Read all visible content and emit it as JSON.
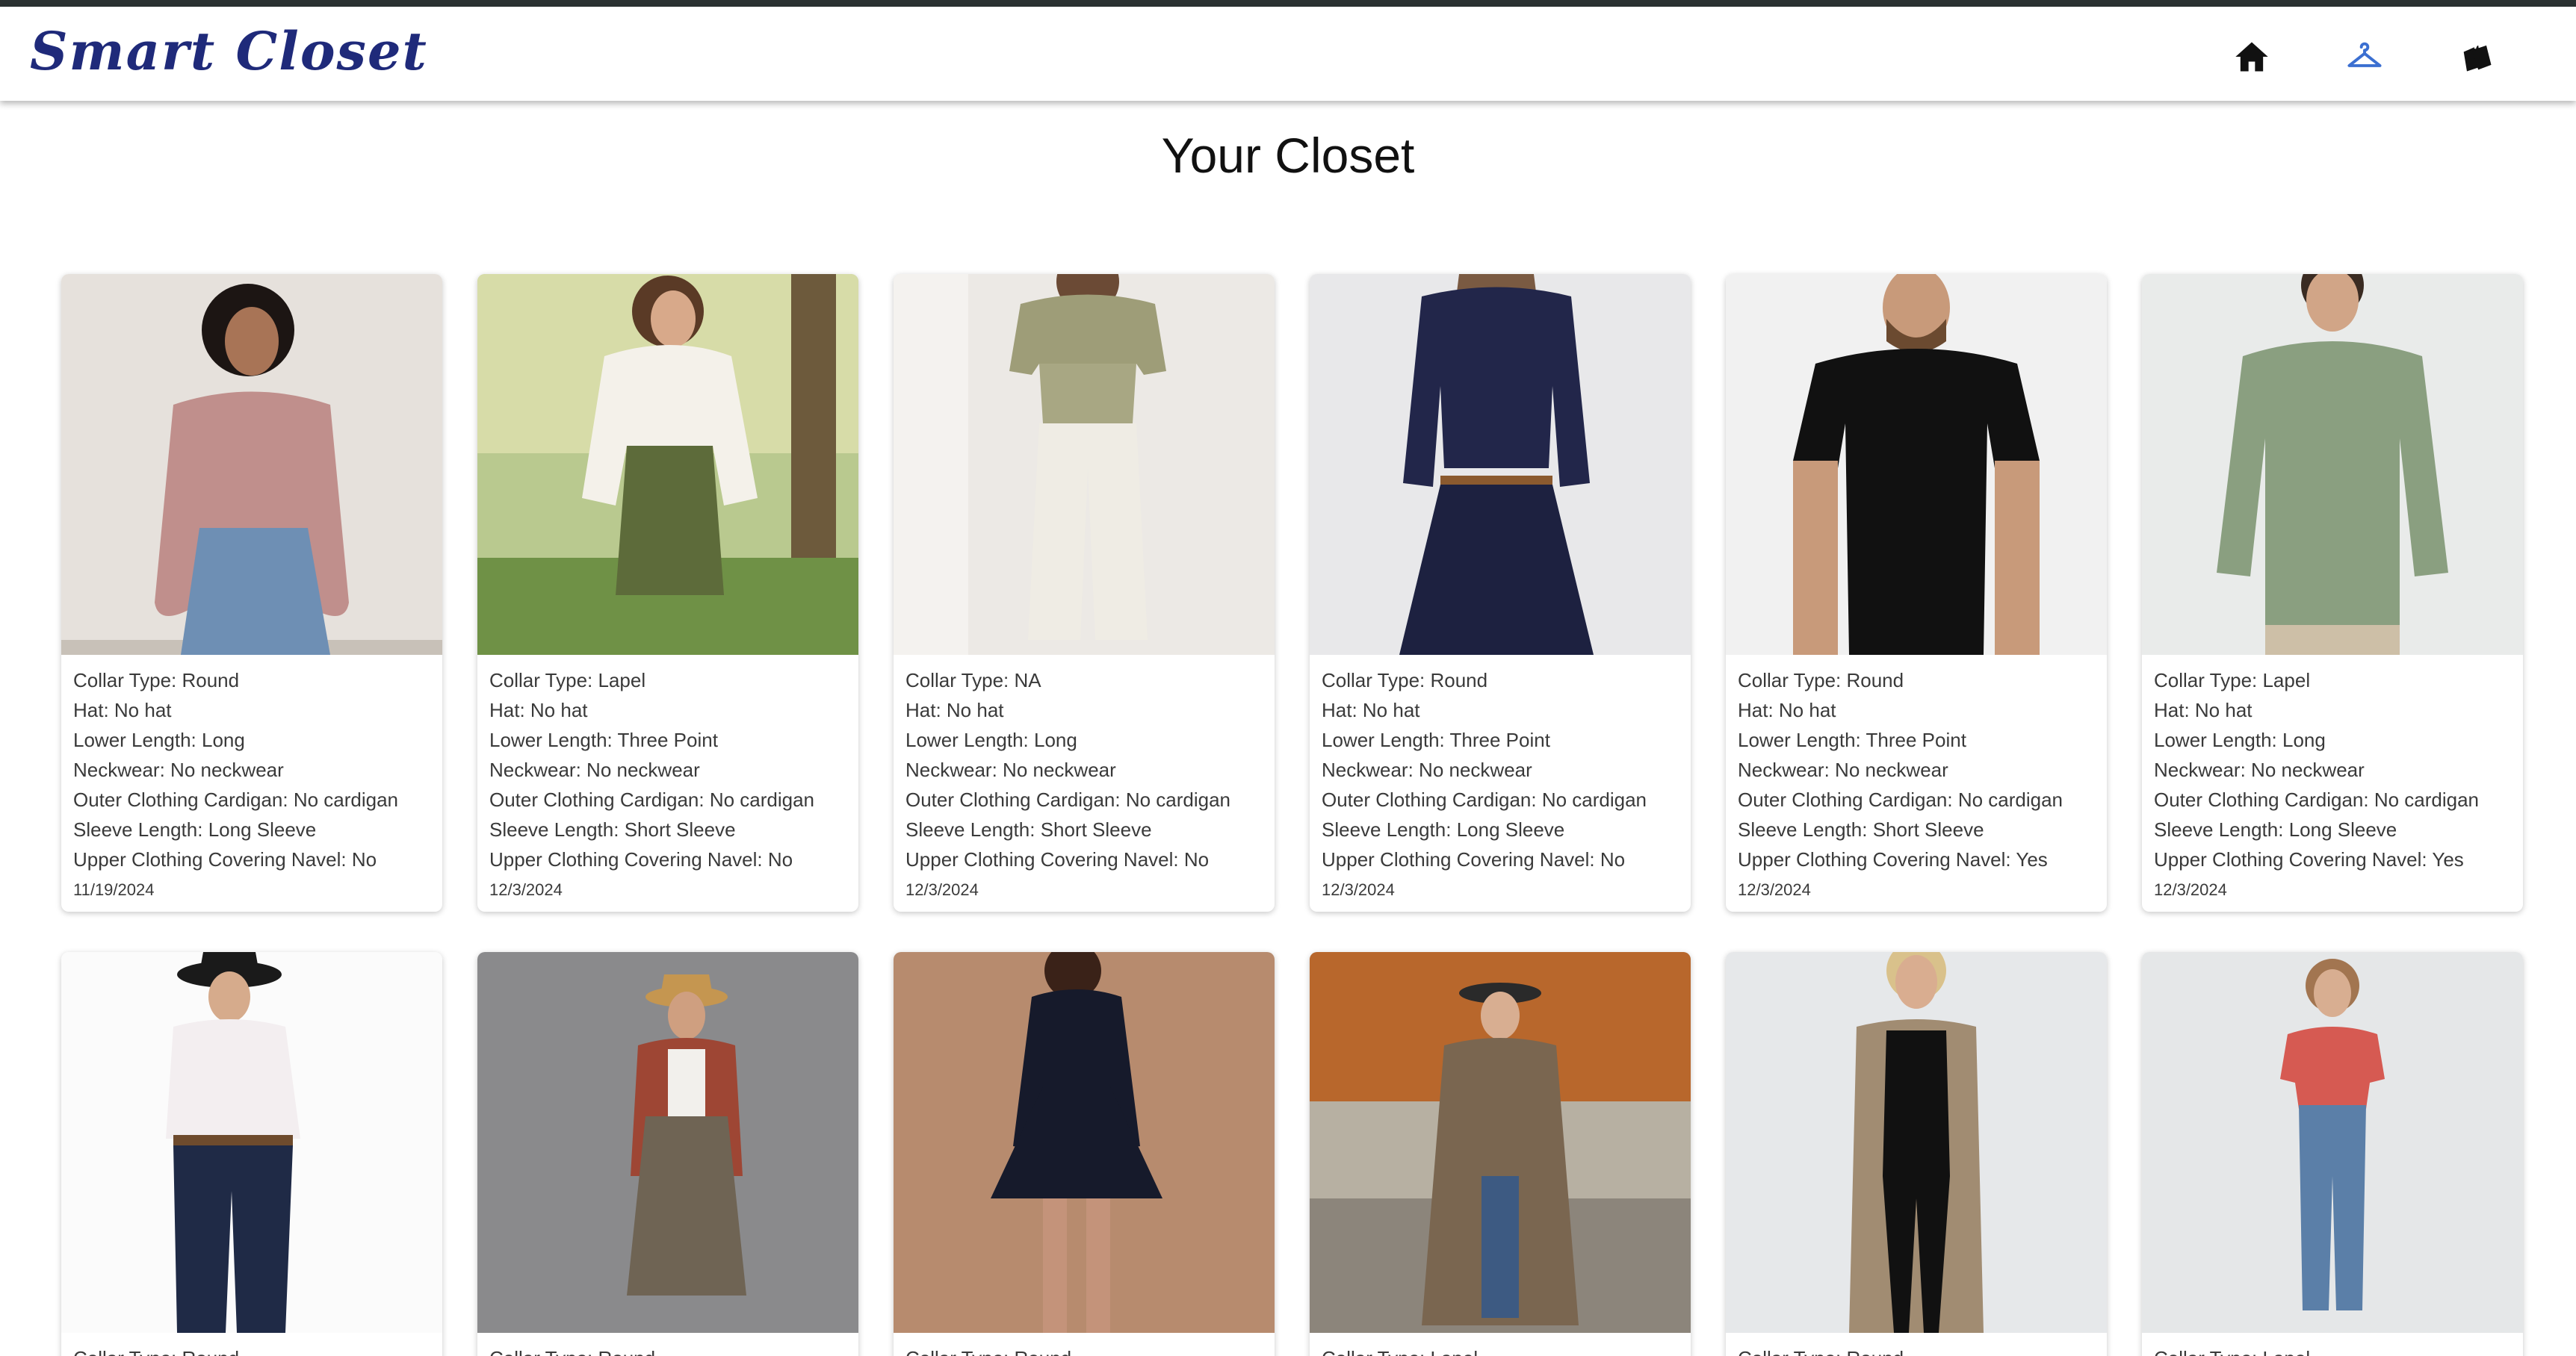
{
  "app": {
    "title": "Smart Closet"
  },
  "nav": {
    "home_icon": "home-icon",
    "closet_icon": "hanger-icon",
    "shop_icon": "shopping-bag-icon",
    "active_color": "#3b6fd1",
    "brand_color": "#1f2a7a"
  },
  "page": {
    "title": "Your Closet"
  },
  "items": [
    {
      "lines": [
        "Collar Type: Round",
        "Hat: No hat",
        "Lower Length: Long",
        "Neckwear: No neckwear",
        "Outer Clothing Cardigan: No cardigan",
        "Sleeve Length: Long Sleeve",
        "Upper Clothing Covering Navel: No"
      ],
      "date": "11/19/2024"
    },
    {
      "lines": [
        "Collar Type: Lapel",
        "Hat: No hat",
        "Lower Length: Three Point",
        "Neckwear: No neckwear",
        "Outer Clothing Cardigan: No cardigan",
        "Sleeve Length: Short Sleeve",
        "Upper Clothing Covering Navel: No"
      ],
      "date": "12/3/2024"
    },
    {
      "lines": [
        "Collar Type: NA",
        "Hat: No hat",
        "Lower Length: Long",
        "Neckwear: No neckwear",
        "Outer Clothing Cardigan: No cardigan",
        "Sleeve Length: Short Sleeve",
        "Upper Clothing Covering Navel: No"
      ],
      "date": "12/3/2024"
    },
    {
      "lines": [
        "Collar Type: Round",
        "Hat: No hat",
        "Lower Length: Three Point",
        "Neckwear: No neckwear",
        "Outer Clothing Cardigan: No cardigan",
        "Sleeve Length: Long Sleeve",
        "Upper Clothing Covering Navel: No"
      ],
      "date": "12/3/2024"
    },
    {
      "lines": [
        "Collar Type: Round",
        "Hat: No hat",
        "Lower Length: Three Point",
        "Neckwear: No neckwear",
        "Outer Clothing Cardigan: No cardigan",
        "Sleeve Length: Short Sleeve",
        "Upper Clothing Covering Navel: Yes"
      ],
      "date": "12/3/2024"
    },
    {
      "lines": [
        "Collar Type: Lapel",
        "Hat: No hat",
        "Lower Length: Long",
        "Neckwear: No neckwear",
        "Outer Clothing Cardigan: No cardigan",
        "Sleeve Length: Long Sleeve",
        "Upper Clothing Covering Navel: Yes"
      ],
      "date": "12/3/2024"
    },
    {
      "lines": [
        "Collar Type: Round"
      ],
      "date": ""
    },
    {
      "lines": [
        "Collar Type: Round"
      ],
      "date": ""
    },
    {
      "lines": [
        "Collar Type: Round"
      ],
      "date": ""
    },
    {
      "lines": [
        "Collar Type: Lapel"
      ],
      "date": ""
    },
    {
      "lines": [
        "Collar Type: Round"
      ],
      "date": ""
    },
    {
      "lines": [
        "Collar Type: Lapel"
      ],
      "date": ""
    }
  ]
}
